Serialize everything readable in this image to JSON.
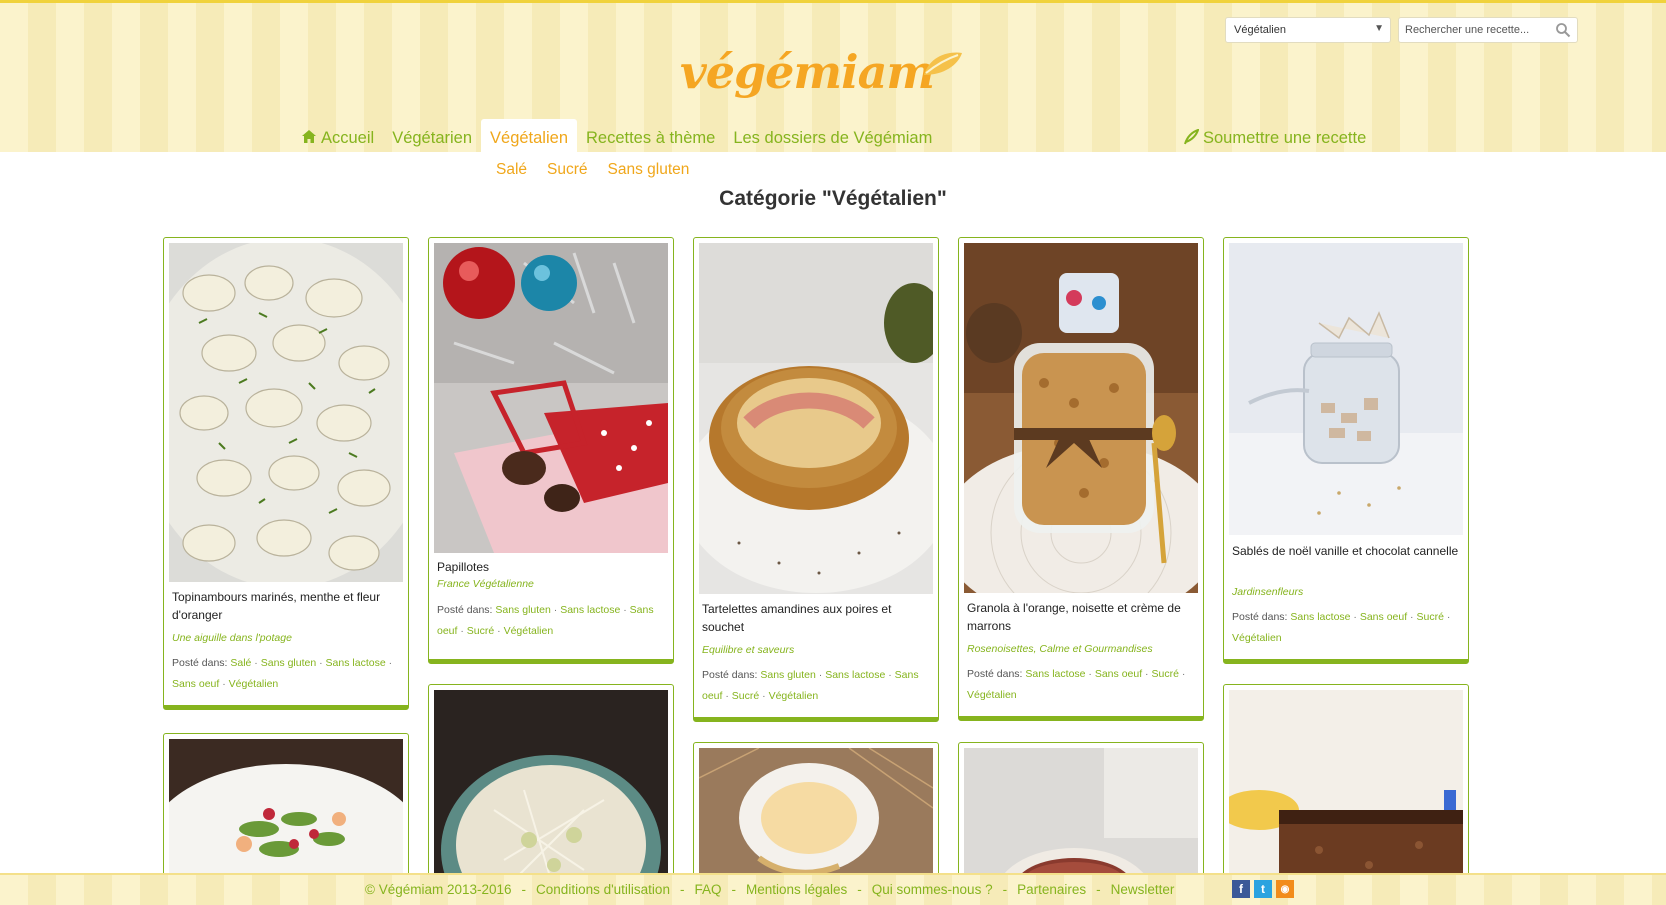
{
  "logo": {
    "text": "végémiam"
  },
  "header": {
    "category_select": {
      "selected": "Végétalien"
    },
    "search": {
      "placeholder": "Rechercher une recette..."
    }
  },
  "nav": {
    "items": [
      {
        "label": "Accueil",
        "icon": "home-icon"
      },
      {
        "label": "Végétarien"
      },
      {
        "label": "Végétalien",
        "active": true
      },
      {
        "label": "Recettes à thème"
      },
      {
        "label": "Les dossiers de Végémiam"
      }
    ],
    "submit": {
      "label": "Soumettre une recette",
      "icon": "leaf-icon"
    }
  },
  "subnav": {
    "items": [
      "Salé",
      "Sucré",
      "Sans gluten"
    ]
  },
  "page_title": "Catégorie \"Végétalien\"",
  "posted_in_label": "Posté dans:",
  "cards": [
    {
      "title": "Topinambours marinés, menthe et fleur d'oranger",
      "author": "Une aiguille dans l'potage",
      "tags": [
        "Salé",
        "Sans gluten",
        "Sans lactose",
        "Sans oeuf",
        "Végétalien"
      ]
    },
    {
      "title": "Papillotes",
      "author": "France Végétalienne",
      "tags": [
        "Sans gluten",
        "Sans lactose",
        "Sans oeuf",
        "Sucré",
        "Végétalien"
      ]
    },
    {
      "title": "Tartelettes amandines aux poires et souchet",
      "author": "Equilibre et saveurs",
      "tags": [
        "Sans gluten",
        "Sans lactose",
        "Sans oeuf",
        "Sucré",
        "Végétalien"
      ]
    },
    {
      "title": "Granola à l'orange, noisette et crème de marrons",
      "author": "Rosenoisettes, Calme et Gourmandises",
      "tags": [
        "Sans lactose",
        "Sans oeuf",
        "Sucré",
        "Végétalien"
      ]
    },
    {
      "title": "Sablés de noël vanille et chocolat cannelle",
      "author": "Jardinsenfleurs",
      "tags": [
        "Sans lactose",
        "Sans oeuf",
        "Sucré",
        "Végétalien"
      ]
    }
  ],
  "footer": {
    "links": [
      "© Végémiam 2013-2016",
      "Conditions d'utilisation",
      "FAQ",
      "Mentions légales",
      "Qui sommes-nous ?",
      "Partenaires",
      "Newsletter"
    ],
    "social": [
      {
        "icon": "facebook-icon",
        "glyph": "f",
        "color": "#3b5998"
      },
      {
        "icon": "twitter-icon",
        "glyph": "t",
        "color": "#2aa3e0"
      },
      {
        "icon": "rss-icon",
        "glyph": "◉",
        "color": "#f28c1a"
      }
    ]
  },
  "colors": {
    "green": "#86b41e",
    "orange": "#f0a71b",
    "header_bg": "#fbf3cc"
  }
}
